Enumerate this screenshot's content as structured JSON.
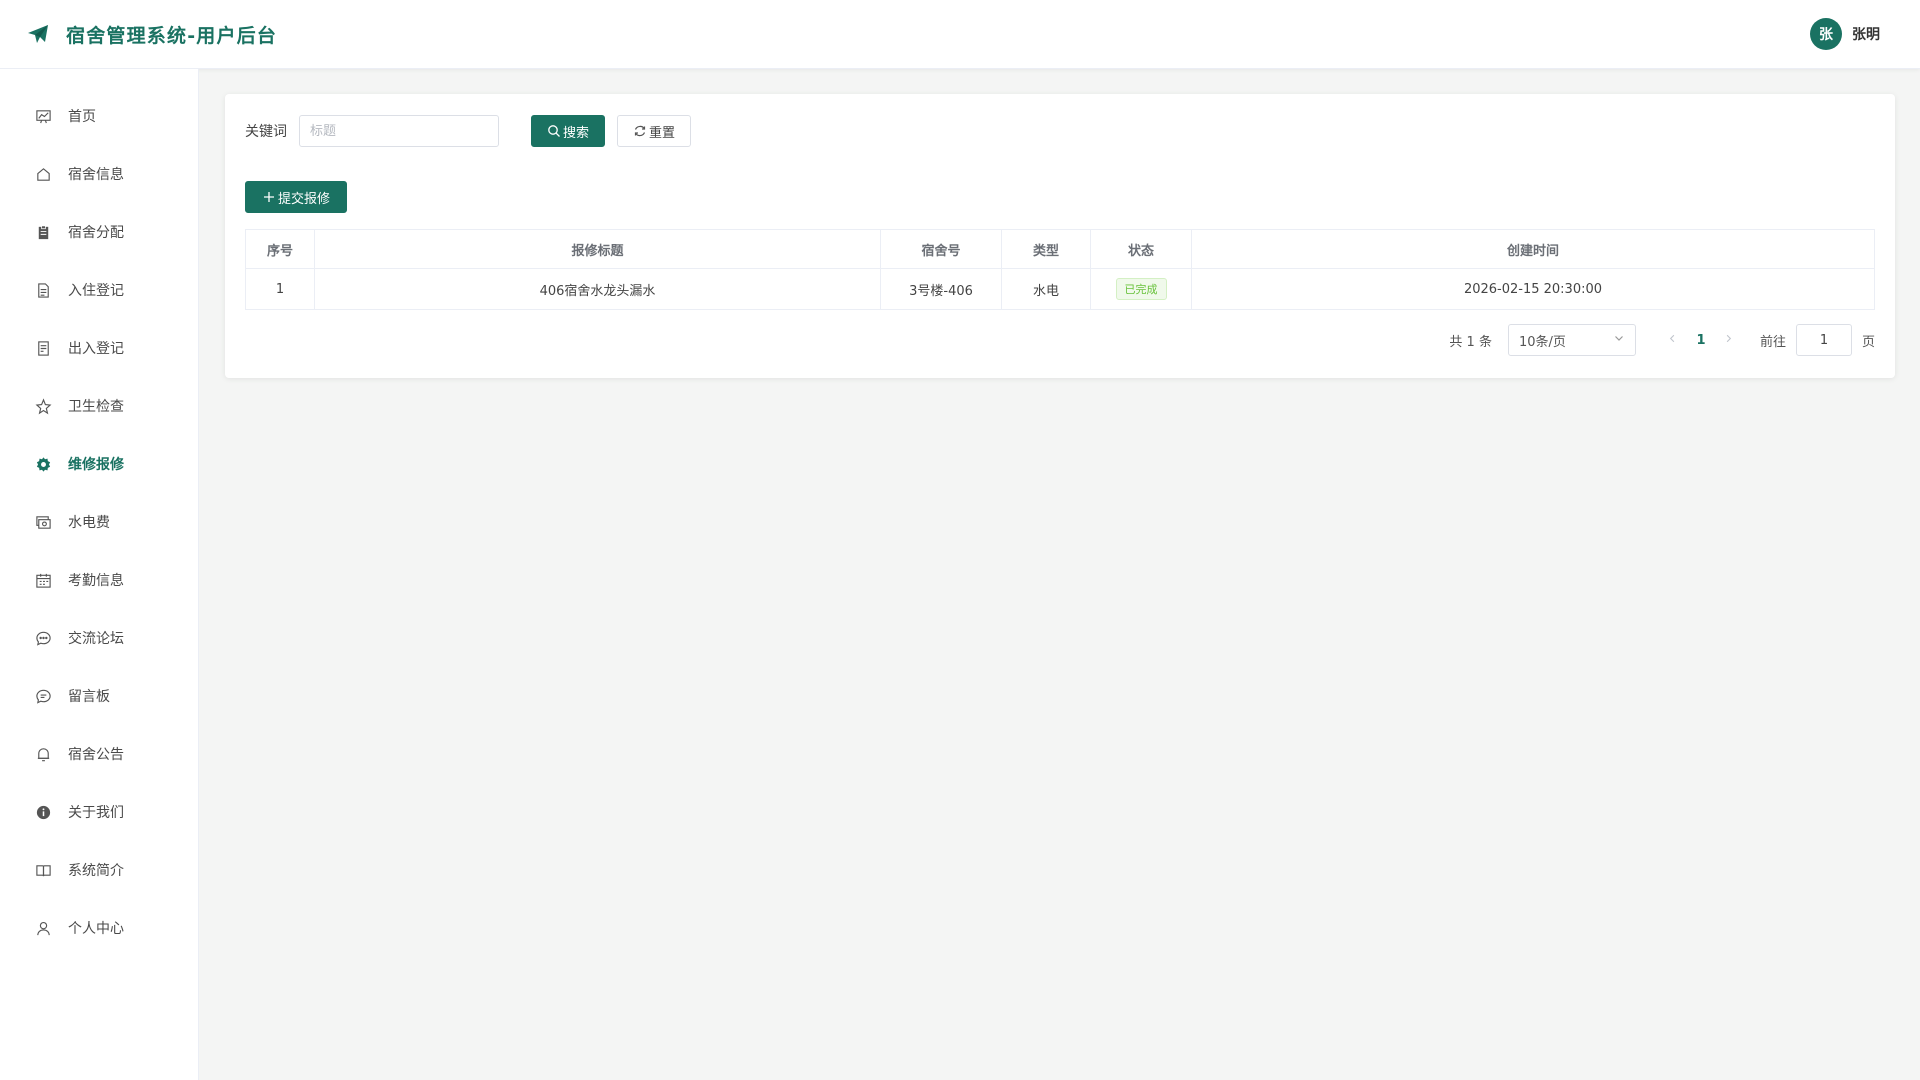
{
  "header": {
    "title": "宿舍管理系统-用户后台",
    "user": {
      "avatar_char": "张",
      "name": "张明"
    }
  },
  "sidebar": {
    "items": [
      {
        "label": "首页",
        "icon": "chart-line-icon"
      },
      {
        "label": "宿舍信息",
        "icon": "home-icon"
      },
      {
        "label": "宿舍分配",
        "icon": "clipboard-icon"
      },
      {
        "label": "入住登记",
        "icon": "document-icon"
      },
      {
        "label": "出入登记",
        "icon": "tickets-icon"
      },
      {
        "label": "卫生检查",
        "icon": "star-icon"
      },
      {
        "label": "维修报修",
        "icon": "gear-icon",
        "active": true
      },
      {
        "label": "水电费",
        "icon": "money-icon"
      },
      {
        "label": "考勤信息",
        "icon": "calendar-icon"
      },
      {
        "label": "交流论坛",
        "icon": "chat-dots-icon"
      },
      {
        "label": "留言板",
        "icon": "chat-line-icon"
      },
      {
        "label": "宿舍公告",
        "icon": "bell-icon"
      },
      {
        "label": "关于我们",
        "icon": "info-icon"
      },
      {
        "label": "系统简介",
        "icon": "book-icon"
      },
      {
        "label": "个人中心",
        "icon": "user-icon"
      }
    ]
  },
  "filter": {
    "label": "关键词",
    "placeholder": "标题",
    "value": "",
    "search_label": "搜索",
    "reset_label": "重置"
  },
  "actions": {
    "submit_label": "提交报修"
  },
  "table": {
    "columns": [
      "序号",
      "报修标题",
      "宿舍号",
      "类型",
      "状态",
      "创建时间"
    ],
    "rows": [
      {
        "index": "1",
        "title": "406宿舍水龙头漏水",
        "room": "3号楼-406",
        "type": "水电",
        "status": "已完成",
        "created": "2026-02-15 20:30:00"
      }
    ]
  },
  "pagination": {
    "total": "共 1 条",
    "page_size": "10条/页",
    "current_page": "1",
    "goto_label": "前往",
    "goto_value": "1",
    "unit": "页"
  },
  "colors": {
    "primary": "#1a7262",
    "success": "#67c23a"
  }
}
